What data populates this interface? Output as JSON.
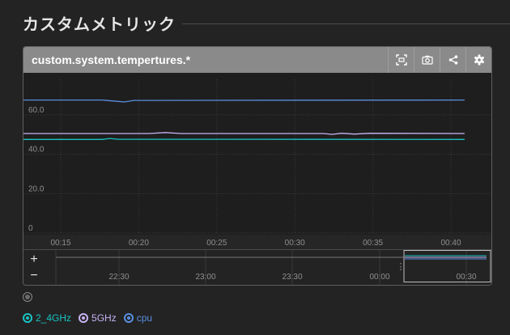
{
  "section": {
    "title": "カスタムメトリック"
  },
  "panel": {
    "title": "custom.system.tempertures.*",
    "buttons": [
      {
        "name": "fullscreen-icon"
      },
      {
        "name": "camera-icon"
      },
      {
        "name": "share-icon"
      },
      {
        "name": "gear-icon"
      }
    ]
  },
  "navigator": {
    "zoom_in": "+",
    "zoom_out": "−",
    "ticks": [
      "22:30",
      "23:00",
      "23:30",
      "00:00",
      "00:30"
    ]
  },
  "legend": {
    "items": [
      {
        "label": "2_4GHz",
        "color": "#19c3c3"
      },
      {
        "label": "5GHz",
        "color": "#c7b3f2"
      },
      {
        "label": "cpu",
        "color": "#5a8fe0"
      }
    ]
  },
  "chart_data": {
    "type": "line",
    "x": [
      "00:15",
      "00:20",
      "00:25",
      "00:30",
      "00:35",
      "00:40"
    ],
    "yticks": [
      0,
      20.0,
      40.0,
      60.0
    ],
    "ylim": [
      0,
      78
    ],
    "grid": true,
    "series": [
      {
        "name": "cpu",
        "color": "#5a8fe0",
        "points": [
          [
            0,
            67.5
          ],
          [
            5,
            67.5
          ],
          [
            6,
            66.8
          ],
          [
            6.4,
            66.5
          ],
          [
            7,
            67.3
          ],
          [
            28,
            67.5
          ]
        ]
      },
      {
        "name": "5GHz",
        "color": "#c7b3f2",
        "points": [
          [
            0,
            50.5
          ],
          [
            8,
            50.5
          ],
          [
            9,
            51
          ],
          [
            10,
            50.5
          ],
          [
            19,
            50.5
          ],
          [
            19.6,
            50.1
          ],
          [
            20.2,
            50.6
          ],
          [
            21,
            50.2
          ],
          [
            22,
            50.6
          ],
          [
            28,
            50.5
          ]
        ]
      },
      {
        "name": "2_4GHz",
        "color": "#19c3c3",
        "points": [
          [
            0,
            47.5
          ],
          [
            5,
            47.5
          ],
          [
            5.5,
            48
          ],
          [
            6,
            47.6
          ],
          [
            28,
            47.5
          ]
        ]
      }
    ]
  }
}
